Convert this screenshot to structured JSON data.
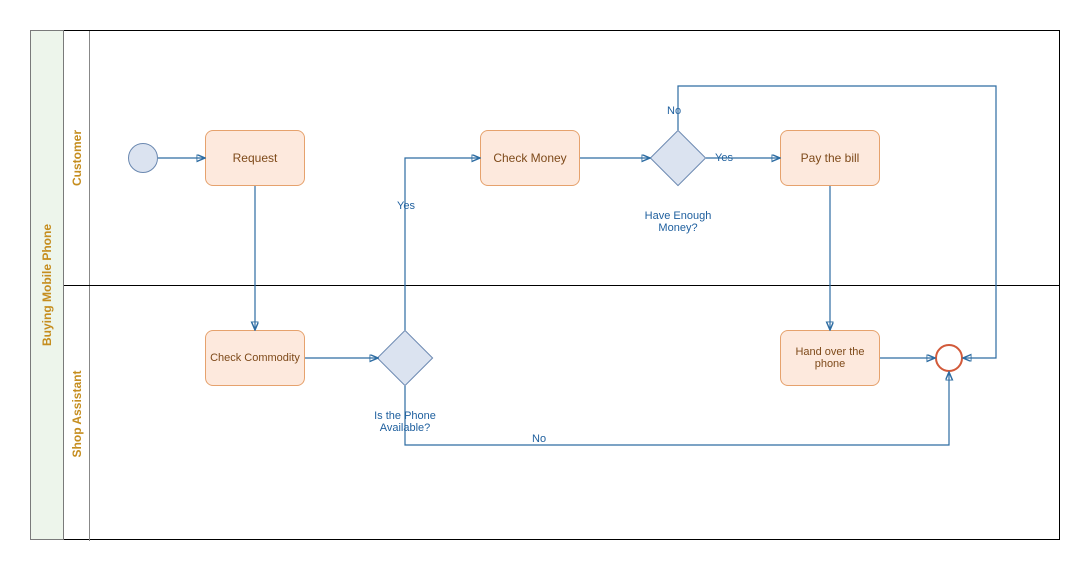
{
  "pool": {
    "title": "Buying Mobile Phone",
    "lanes": {
      "customer": {
        "title": "Customer"
      },
      "assistant": {
        "title": "Shop Assistant"
      }
    }
  },
  "tasks": {
    "request": "Request",
    "check_money": "Check Money",
    "pay_bill": "Pay the bill",
    "check_commodity": "Check Commodity",
    "hand_over": "Hand over the phone"
  },
  "gateways": {
    "phone_available": {
      "label": "Is the Phone Available?"
    },
    "enough_money": {
      "label": "Have Enough Money?"
    }
  },
  "edge_labels": {
    "yes_phone": "Yes",
    "no_phone": "No",
    "yes_money": "Yes",
    "no_money": "No"
  }
}
